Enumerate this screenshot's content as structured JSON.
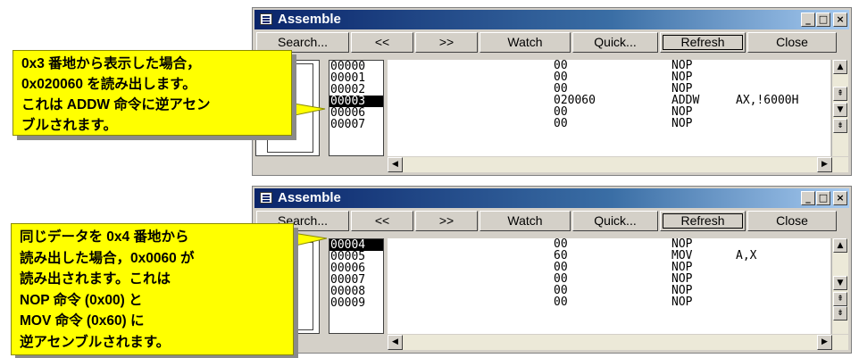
{
  "window1": {
    "title": "Assemble",
    "controls": {
      "minimize": "_",
      "maximize": "□",
      "close": "×"
    },
    "toolbar": [
      "Search...",
      "<<",
      ">>",
      "Watch",
      "Quick...",
      "Refresh",
      "Close"
    ],
    "addresses": [
      "00000",
      "00001",
      "00002",
      "00003",
      "00006",
      "00007"
    ],
    "selected_address": "00003",
    "rows": [
      {
        "code": "00",
        "mnemonic": "NOP",
        "operand": ""
      },
      {
        "code": "00",
        "mnemonic": "NOP",
        "operand": ""
      },
      {
        "code": "00",
        "mnemonic": "NOP",
        "operand": ""
      },
      {
        "code": "020060",
        "mnemonic": "ADDW",
        "operand": "AX,!6000H"
      },
      {
        "code": "00",
        "mnemonic": "NOP",
        "operand": ""
      },
      {
        "code": "00",
        "mnemonic": "NOP",
        "operand": ""
      }
    ],
    "callout": [
      "0x3 番地から表示した場合，",
      "0x020060 を読み出します。",
      "これは ADDW 命令に逆アセン",
      "ブルされます。"
    ]
  },
  "window2": {
    "title": "Assemble",
    "controls": {
      "minimize": "_",
      "maximize": "□",
      "close": "×"
    },
    "toolbar": [
      "Search...",
      "<<",
      ">>",
      "Watch",
      "Quick...",
      "Refresh",
      "Close"
    ],
    "addresses": [
      "00004",
      "00005",
      "00006",
      "00007",
      "00008",
      "00009"
    ],
    "selected_address": "00004",
    "rows": [
      {
        "code": "00",
        "mnemonic": "NOP",
        "operand": ""
      },
      {
        "code": "60",
        "mnemonic": "MOV",
        "operand": "A,X"
      },
      {
        "code": "00",
        "mnemonic": "NOP",
        "operand": ""
      },
      {
        "code": "00",
        "mnemonic": "NOP",
        "operand": ""
      },
      {
        "code": "00",
        "mnemonic": "NOP",
        "operand": ""
      },
      {
        "code": "00",
        "mnemonic": "NOP",
        "operand": ""
      }
    ],
    "callout": [
      "同じデータを 0x4 番地から",
      "読み出した場合，0x0060 が",
      "読み出されます。これは",
      "NOP 命令 (0x00) と",
      "MOV 命令 (0x60) に",
      "逆アセンブルされます。"
    ]
  },
  "colors": {
    "callout": "#ffff00",
    "titlebar": "#0a246a",
    "window": "#d4d0c8"
  }
}
